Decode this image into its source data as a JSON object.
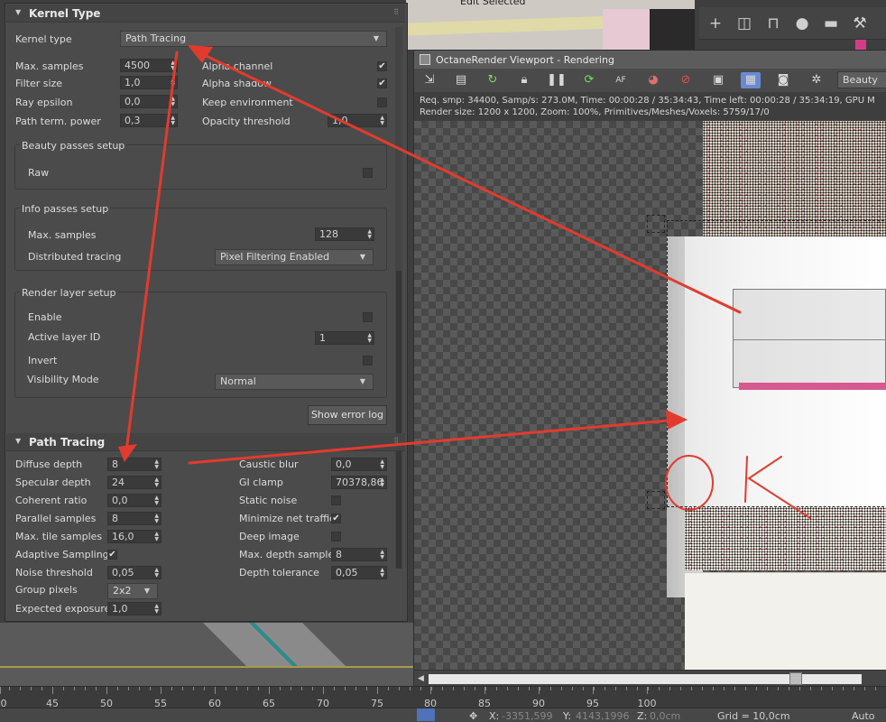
{
  "background": {
    "top_label": "Edit Selected",
    "right_toolbar_icons": [
      "plus-icon",
      "modify-icon",
      "hierarchy-icon",
      "motion-icon",
      "display-icon",
      "utilities-icon"
    ]
  },
  "kernel_rollout": {
    "title": "Kernel Type",
    "kernel_type_label": "Kernel type",
    "kernel_type_value": "Path Tracing",
    "max_samples_label": "Max. samples",
    "max_samples_value": "4500",
    "filter_size_label": "Filter size",
    "filter_size_value": "1,0",
    "ray_epsilon_label": "Ray epsilon",
    "ray_epsilon_value": "0,0",
    "path_term_label": "Path term. power",
    "path_term_value": "0,3",
    "alpha_channel_label": "Alpha channel",
    "alpha_channel_checked": true,
    "alpha_shadow_label": "Alpha shadow",
    "alpha_shadow_checked": true,
    "keep_env_label": "Keep environment",
    "keep_env_checked": false,
    "opacity_label": "Opacity threshold",
    "opacity_value": "1,0",
    "beauty_group": {
      "title": "Beauty passes setup",
      "raw_label": "Raw",
      "raw_checked": false
    },
    "info_group": {
      "title": "Info passes setup",
      "max_samples_label": "Max. samples",
      "max_samples_value": "128",
      "distributed_label": "Distributed tracing",
      "distributed_value": "Pixel Filtering Enabled"
    },
    "layer_group": {
      "title": "Render layer setup",
      "enable_label": "Enable",
      "active_layer_label": "Active layer ID",
      "active_layer_value": "1",
      "invert_label": "Invert",
      "visibility_label": "Visibility Mode",
      "visibility_value": "Normal"
    },
    "show_error_log": "Show error log"
  },
  "path_rollout": {
    "title": "Path Tracing",
    "left": [
      {
        "label": "Diffuse depth",
        "value": "8",
        "type": "spin"
      },
      {
        "label": "Specular depth",
        "value": "24",
        "type": "spin"
      },
      {
        "label": "Coherent ratio",
        "value": "0,0",
        "type": "spin"
      },
      {
        "label": "Parallel samples",
        "value": "8",
        "type": "spin"
      },
      {
        "label": "Max. tile samples",
        "value": "16,0",
        "type": "spin"
      },
      {
        "label": "Adaptive Sampling",
        "value": "",
        "type": "check",
        "checked": true
      },
      {
        "label": "Noise threshold",
        "value": "0,05",
        "type": "spin"
      },
      {
        "label": "Group pixels",
        "value": "2x2",
        "type": "drop"
      },
      {
        "label": "Expected exposure",
        "value": "1,0",
        "type": "spin"
      }
    ],
    "right": [
      {
        "label": "Caustic blur",
        "value": "0,0",
        "type": "spin"
      },
      {
        "label": "GI clamp",
        "value": "70378,86",
        "type": "spin"
      },
      {
        "label": "Static noise",
        "value": "",
        "type": "check",
        "checked": false
      },
      {
        "label": "Minimize net traffic",
        "value": "",
        "type": "check",
        "checked": true
      },
      {
        "label": "Deep image",
        "value": "",
        "type": "check",
        "checked": false
      },
      {
        "label": "Max. depth samples",
        "value": "8",
        "type": "spin"
      },
      {
        "label": "Depth tolerance",
        "value": "0,05",
        "type": "spin"
      }
    ]
  },
  "octane": {
    "title": "OctaneRender Viewport - Rendering",
    "beauty": "Beauty",
    "info_line1": "Req. smp: 34400,   Samp/s: 273.0M,   Time: 00:00:28 / 35:34:43,   Time left: 00:00:28 / 35:34:19,   GPU M",
    "info_line2": "Render size: 1200 x 1200,   Zoom: 100%,   Primitives/Meshes/Voxels: 5759/17/0",
    "tool_icons": [
      "send-icon",
      "copy-icon",
      "restart-icon",
      "lock-icon",
      "pause-icon",
      "refresh-icon",
      "af-icon",
      "color-icon",
      "no-clay-icon",
      "region-icon",
      "film-icon",
      "camera-icon",
      "settings-icon"
    ],
    "annotation_text": "OK"
  },
  "ruler": {
    "ticks": [
      "0",
      "45",
      "50",
      "55",
      "60",
      "65",
      "70",
      "75",
      "80",
      "85",
      "90",
      "95",
      "100"
    ]
  },
  "status": {
    "x_label": "X:",
    "x_value": "-3351,599",
    "y_label": "Y:",
    "y_value": "4143,1996",
    "z_label": "Z:",
    "z_value": "0,0cm",
    "grid": "Grid = 10,0cm",
    "autokey": "Auto Ke"
  },
  "colors": {
    "annotation_red": "#e23b2e",
    "panel_bg": "#4b4b4b",
    "selected_tool": "#6a8ad0"
  }
}
